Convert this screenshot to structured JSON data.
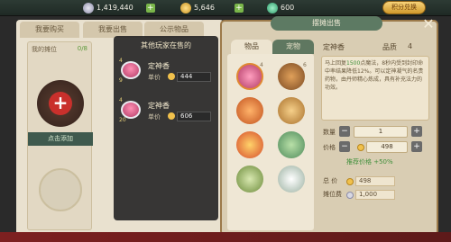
{
  "currencies": [
    {
      "icon": "silver-coin-icon",
      "value": "1,419,440"
    },
    {
      "icon": "gold-coin-icon",
      "value": "5,646"
    },
    {
      "icon": "jade-coin-icon",
      "value": "600"
    }
  ],
  "gold_button": "积分兑换",
  "left_tabs": [
    "我要购买",
    "我要出售",
    "公示物品"
  ],
  "my_stall": {
    "label": "我的摊位",
    "count": "0/8",
    "add_label": "点击添加"
  },
  "others": {
    "title": "其他玩家在售的",
    "items": [
      {
        "name": "定神香",
        "top_num": "4",
        "bottom_num": "9",
        "price_label": "单价",
        "price": "444"
      },
      {
        "name": "定神香",
        "top_num": "4",
        "bottom_num": "20",
        "price_label": "单价",
        "price": "606"
      }
    ]
  },
  "dialog": {
    "title": "摆摊出售",
    "tabs": [
      "物品",
      "宠物"
    ],
    "grid_counts": [
      "4",
      "6",
      "",
      "",
      "",
      "",
      "",
      "",
      "",
      ""
    ],
    "item_name": "定神香",
    "quality_label": "品质",
    "quality": "4",
    "desc_pre": "马上回复",
    "desc_hl": "1500",
    "desc_post": "点魔法，8秒内受到封印命中率结果降低12%。可以定神凝气的名贵药物，由丹师精心炼成，具有补充法力的功效。",
    "qty_label": "数量",
    "qty_value": "1",
    "price_label": "价格",
    "price_value": "498",
    "recommend": "推荐价格 +50%",
    "total_label": "总  价",
    "total_value": "498",
    "fee_label": "摊位费",
    "fee_value": "1,000"
  }
}
